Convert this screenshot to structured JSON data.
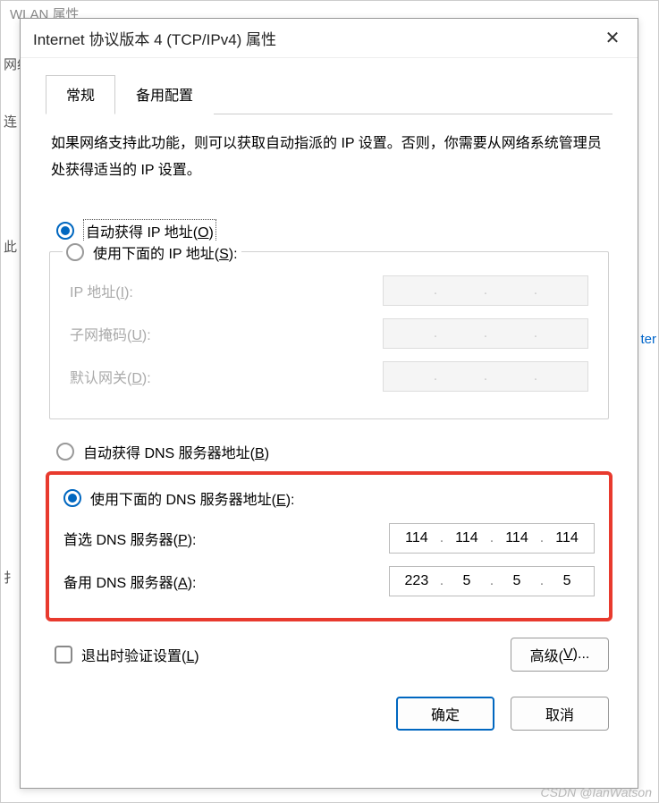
{
  "background": {
    "title": "WLAN 属性",
    "label_net": "网络",
    "label_conn": "连",
    "label_this": "此",
    "label_edit": "扌",
    "link_fragment": "ter"
  },
  "dialog": {
    "title": "Internet 协议版本 4 (TCP/IPv4) 属性",
    "tabs": {
      "general": "常规",
      "alternate": "备用配置"
    },
    "description": "如果网络支持此功能，则可以获取自动指派的 IP 设置。否则，你需要从网络系统管理员处获得适当的 IP 设置。",
    "ip": {
      "auto": "自动获得 IP 地址(O)",
      "manual": "使用下面的 IP 地址(S):",
      "ip_label": "IP 地址(I):",
      "mask_label": "子网掩码(U):",
      "gateway_label": "默认网关(D):",
      "selected": "auto"
    },
    "dns": {
      "auto": "自动获得 DNS 服务器地址(B)",
      "manual": "使用下面的 DNS 服务器地址(E):",
      "pref_label": "首选 DNS 服务器(P):",
      "alt_label": "备用 DNS 服务器(A):",
      "preferred": [
        "114",
        "114",
        "114",
        "114"
      ],
      "alternate": [
        "223",
        "5",
        "5",
        "5"
      ],
      "selected": "manual"
    },
    "validate": "退出时验证设置(L)",
    "advanced": "高级(V)...",
    "ok": "确定",
    "cancel": "取消"
  },
  "watermark": "CSDN @IanWatson"
}
